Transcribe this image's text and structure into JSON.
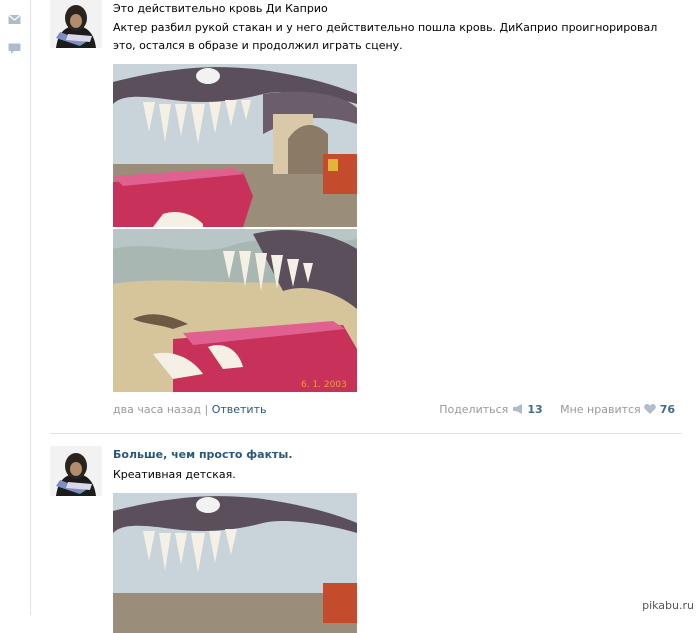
{
  "post1": {
    "title": "Это действительно кровь Ди Каприо",
    "text": "Актер разбил рукой стакан и у него действительно пошла кровь. ДиКаприо проигнорировал это, остался в образе и продолжил играть сцену.",
    "time": "два часа назад",
    "reply": "Ответить",
    "share_label": "Поделиться",
    "share_count": "13",
    "like_label": "Мне нравится",
    "like_count": "76"
  },
  "post2": {
    "author": "Больше, чем просто факты.",
    "text": "Креативная детская."
  },
  "photo_stamp": "6. 1. 2003",
  "watermark": "pikabu.ru",
  "colors": {
    "link": "#2b587a",
    "muted": "#999999",
    "divider": "#dfe3e8"
  },
  "icons": [
    "mail-icon",
    "comment-icon",
    "megaphone-icon",
    "heart-icon"
  ]
}
